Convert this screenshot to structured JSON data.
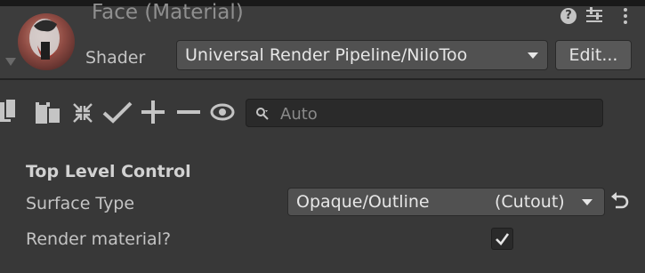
{
  "header": {
    "title": "Face (Material)",
    "shader_label": "Shader",
    "shader_value": "Universal Render Pipeline/NiloToo",
    "edit_label": "Edit...",
    "help_glyph": "?"
  },
  "toolbar": {
    "icons": [
      "copy-icon",
      "paste-icon",
      "collapse-icon",
      "check-icon",
      "plus-icon",
      "minus-icon",
      "eye-icon"
    ],
    "search_placeholder": "Auto"
  },
  "section": {
    "title": "Top Level Control",
    "properties": [
      {
        "label": "Surface Type",
        "value_main": "Opaque/Outline",
        "value_suffix": "(Cutout)"
      },
      {
        "label": "Render material?",
        "checked": true
      }
    ]
  },
  "colors": {
    "background": "#383838",
    "header_background": "#3c3c3c",
    "field_background": "#2a2a2a",
    "dropdown_background": "#515151",
    "text": "#c4c4c4"
  }
}
